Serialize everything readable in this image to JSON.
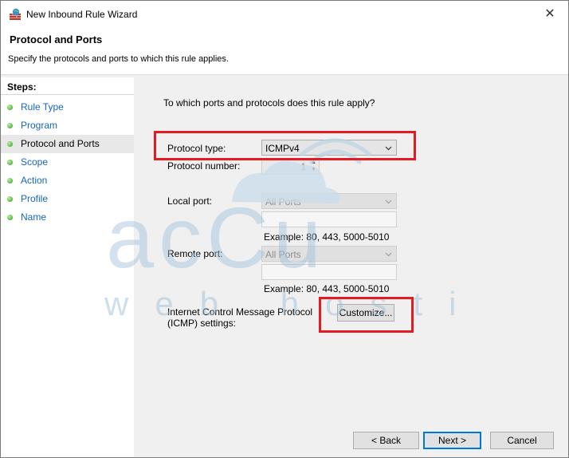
{
  "window": {
    "title": "New Inbound Rule Wizard",
    "close_glyph": "✕"
  },
  "header": {
    "title": "Protocol and Ports",
    "subtitle": "Specify the protocols and ports to which this rule applies."
  },
  "sidebar": {
    "title": "Steps:",
    "steps": [
      {
        "label": "Rule Type",
        "active": false
      },
      {
        "label": "Program",
        "active": false
      },
      {
        "label": "Protocol and Ports",
        "active": true
      },
      {
        "label": "Scope",
        "active": false
      },
      {
        "label": "Action",
        "active": false
      },
      {
        "label": "Profile",
        "active": false
      },
      {
        "label": "Name",
        "active": false
      }
    ]
  },
  "main": {
    "question": "To which ports and protocols does this rule apply?",
    "protocol_type": {
      "label": "Protocol type:",
      "value": "ICMPv4"
    },
    "protocol_number": {
      "label": "Protocol number:",
      "value": "1"
    },
    "local_port": {
      "label": "Local port:",
      "value": "All Ports",
      "example": "Example: 80, 443, 5000-5010"
    },
    "remote_port": {
      "label": "Remote port:",
      "value": "All Ports",
      "example": "Example: 80, 443, 5000-5010"
    },
    "icmp": {
      "label_line1": "Internet Control Message Protocol",
      "label_line2": "(ICMP) settings:",
      "button": "Customize..."
    }
  },
  "footer": {
    "back": "< Back",
    "next": "Next >",
    "cancel": "Cancel"
  },
  "watermark": {
    "brand": "acCu",
    "tagline": "web hosting"
  },
  "colors": {
    "highlight": "#e41b23",
    "link": "#1565c0",
    "accent": "#0078d7"
  }
}
